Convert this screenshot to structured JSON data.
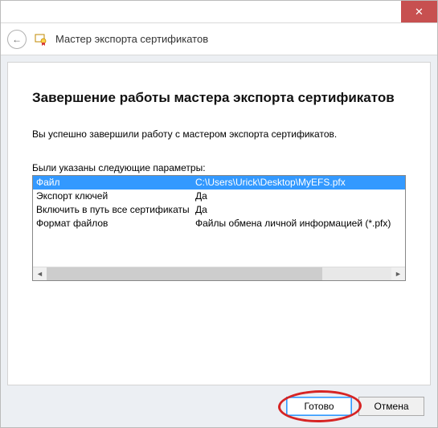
{
  "titlebar": {
    "close_glyph": "✕"
  },
  "header": {
    "back_glyph": "←",
    "title": "Мастер экспорта сертификатов"
  },
  "main": {
    "heading": "Завершение работы мастера экспорта сертификатов",
    "subtext": "Вы успешно завершили работу с мастером экспорта сертификатов.",
    "params_label": "Были указаны следующие параметры:",
    "rows": [
      {
        "k": "Файл",
        "v": "C:\\Users\\Urick\\Desktop\\MyEFS.pfx"
      },
      {
        "k": "Экспорт ключей",
        "v": "Да"
      },
      {
        "k": "Включить в путь все сертификаты",
        "v": "Да"
      },
      {
        "k": "Формат файлов",
        "v": "Файлы обмена личной информацией (*.pfx)"
      }
    ]
  },
  "buttons": {
    "finish": "Готово",
    "cancel": "Отмена"
  },
  "scroll": {
    "left": "◄",
    "right": "►"
  }
}
